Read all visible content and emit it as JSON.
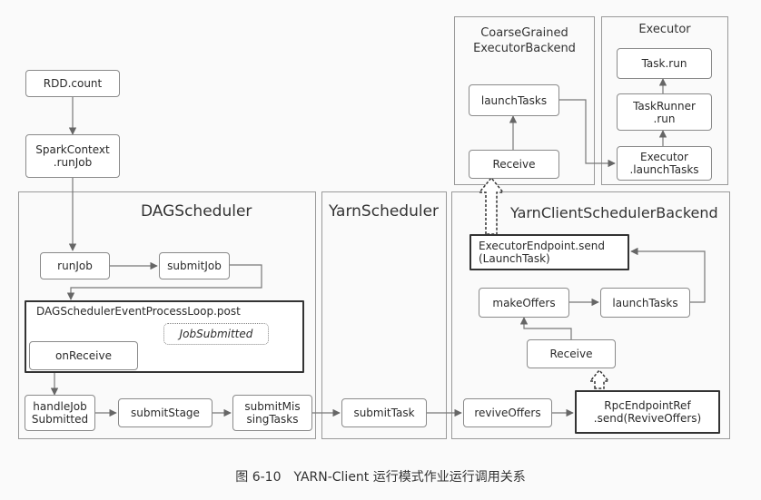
{
  "regions": {
    "dag": "DAGScheduler",
    "yarn": "YarnScheduler",
    "ycsb": "YarnClientSchedulerBackend",
    "cgeb": "CoarseGrained\nExecutorBackend",
    "executor": "Executor"
  },
  "nodes": {
    "rdd_count": "RDD.count",
    "spark_context": "SparkContext\n.runJob",
    "run_job": "runJob",
    "submit_job": "submitJob",
    "event_loop_post": "DAGSchedulerEventProcessLoop.post",
    "on_receive": "onReceive",
    "job_submitted": "JobSubmitted",
    "handle_job_submitted": "handleJob\nSubmitted",
    "submit_stage": "submitStage",
    "submit_missing_tasks": "submitMis\nsingTasks",
    "submit_task": "submitTask",
    "revive_offers": "reviveOffers",
    "rpc_send": "RpcEndpointRef\n.send(ReviveOffers)",
    "receive_backend": "Receive",
    "make_offers": "makeOffers",
    "launch_tasks_backend": "launchTasks",
    "executor_endpoint_send": "ExecutorEndpoint.send\n(LaunchTask)",
    "receive_cgeb": "Receive",
    "launch_tasks_cgeb": "launchTasks",
    "executor_launch_tasks": "Executor\n.launchTasks",
    "task_runner_run": "TaskRunner\n.run",
    "task_run": "Task.run"
  },
  "caption": "图 6-10　YARN-Client 运行模式作业运行调用关系"
}
